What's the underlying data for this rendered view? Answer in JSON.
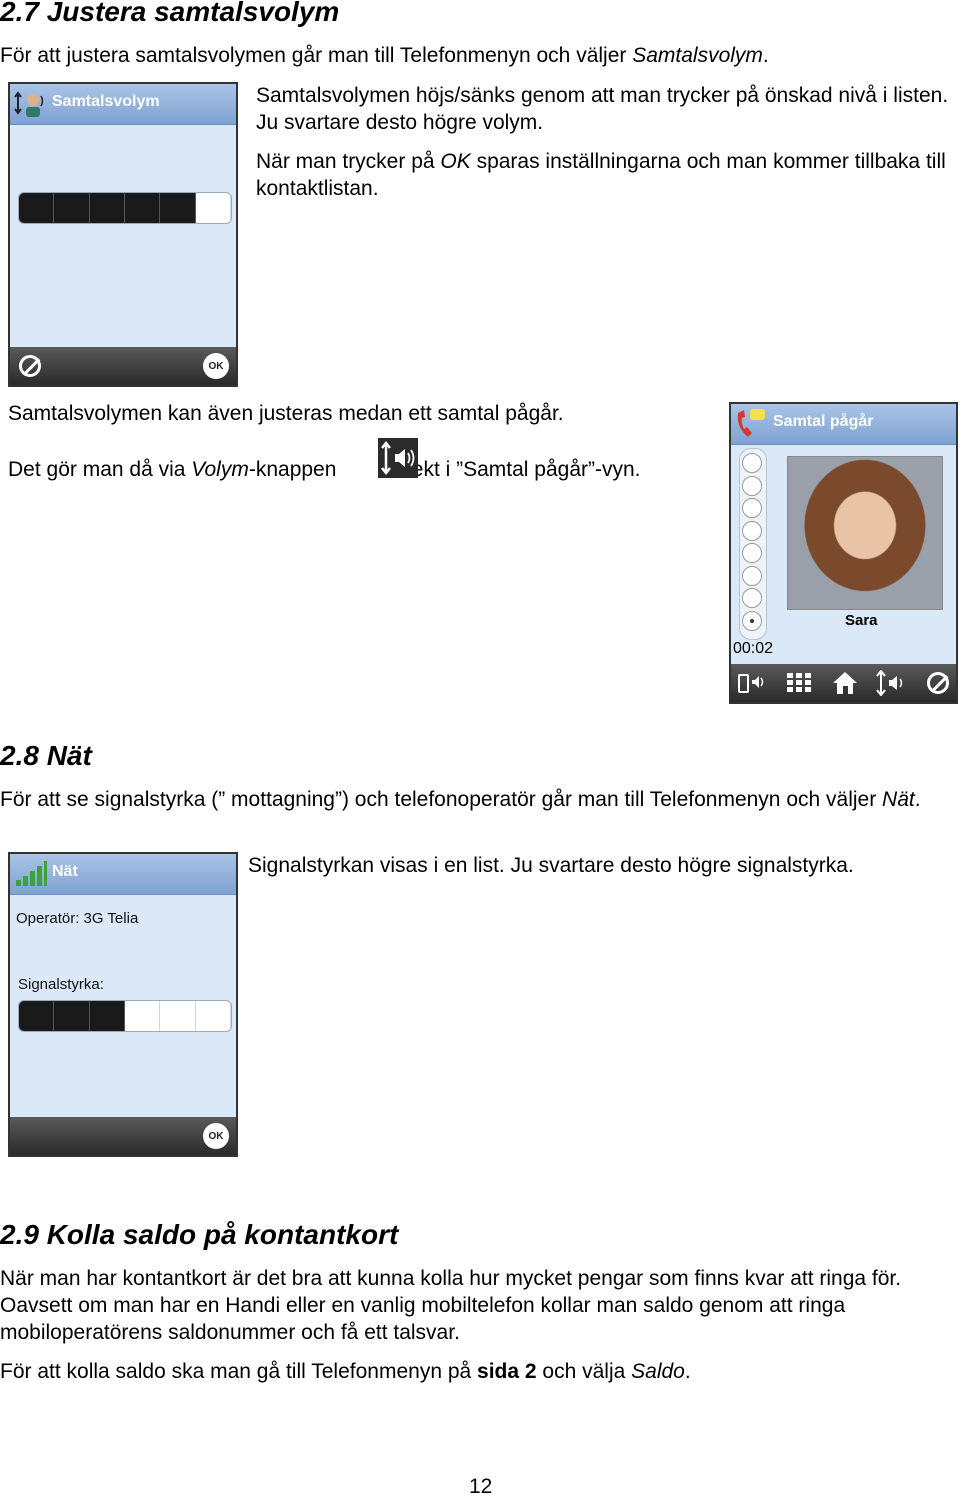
{
  "section_27": {
    "heading": "2.7 Justera samtalsvolym",
    "intro_pre": "För att justera samtalsvolymen går man till Telefonmenyn och väljer ",
    "intro_em": "Samtalsvolym",
    "intro_post": ".",
    "para1": "Samtalsvolymen höjs/sänks genom att man trycker på önskad nivå i listen. Ju svartare desto högre volym.",
    "para2_pre": "När man trycker på ",
    "para2_em": "OK",
    "para2_post": " sparas inställningarna och man kommer tillbaka till kontaktlistan.",
    "para3": "Samtalsvolymen kan även justeras medan ett samtal pågår.",
    "para4_pre": "Det gör man då via ",
    "para4_em": "Volym",
    "para4_mid": "-knappen",
    "para4_post": "direkt i ”Samtal pågår”-vyn.",
    "phone_volume": {
      "title": "Samtalsvolym",
      "volume_level": 5,
      "volume_max": 6,
      "ok_label": "OK"
    },
    "phone_call": {
      "title": "Samtal pågår",
      "contact_name": "Sara",
      "timer": "00:02",
      "volume_level": 1,
      "volume_max": 8
    }
  },
  "section_28": {
    "heading": "2.8 Nät",
    "intro_pre": "För att se signalstyrka (” mottagning”) och telefonoperatör går man till Telefonmenyn och väljer ",
    "intro_em": "Nät",
    "intro_post": ".",
    "para1": "Signalstyrkan visas i en list. Ju svartare desto högre signalstyrka.",
    "phone_network": {
      "title": "Nät",
      "operator": "Operatör: 3G Telia",
      "signal_label": "Signalstyrka:",
      "signal_level": 3,
      "signal_max": 6,
      "ok_label": "OK"
    }
  },
  "section_29": {
    "heading": "2.9 Kolla saldo på kontantkort",
    "para1": "När man har kontantkort är det bra att kunna kolla hur mycket pengar som finns kvar att ringa för. Oavsett om man har en Handi eller en vanlig mobiltelefon kollar man saldo genom att ringa mobiloperatörens saldonummer och få ett talsvar.",
    "para2_pre": "För att kolla saldo ska man gå till Telefonmenyn på ",
    "para2_bold": "sida 2",
    "para2_mid": " och välja ",
    "para2_em": "Saldo",
    "para2_post": "."
  },
  "page_number": "12"
}
